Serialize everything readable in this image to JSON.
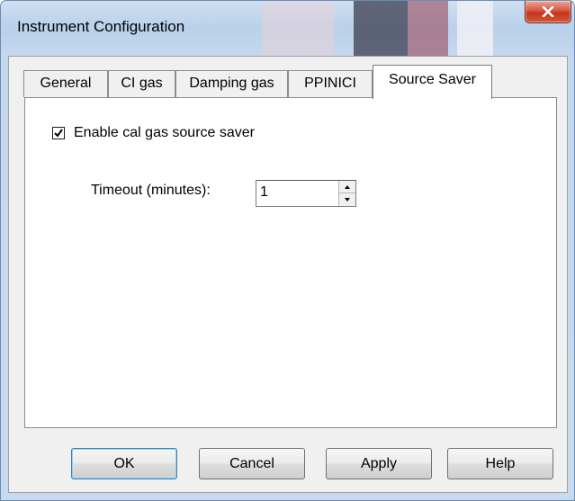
{
  "window": {
    "title": "Instrument Configuration",
    "close_icon": "close-icon"
  },
  "tabs": [
    {
      "label": "General",
      "active": false
    },
    {
      "label": "CI gas",
      "active": false
    },
    {
      "label": "Damping gas",
      "active": false
    },
    {
      "label": "PPINICI",
      "active": false
    },
    {
      "label": "Source Saver",
      "active": true
    }
  ],
  "source_saver": {
    "enable_label": "Enable cal gas source saver",
    "enable_checked": true,
    "timeout_label": "Timeout (minutes):",
    "timeout_value": "1"
  },
  "buttons": {
    "ok": "OK",
    "cancel": "Cancel",
    "apply": "Apply",
    "help": "Help"
  },
  "colors": {
    "title_bar": "#c4d8ee",
    "close_button": "#c2351c",
    "dialog_bg": "#f0f0f0",
    "tab_page_bg": "#ffffff",
    "default_button_border": "#3c7fb1"
  }
}
